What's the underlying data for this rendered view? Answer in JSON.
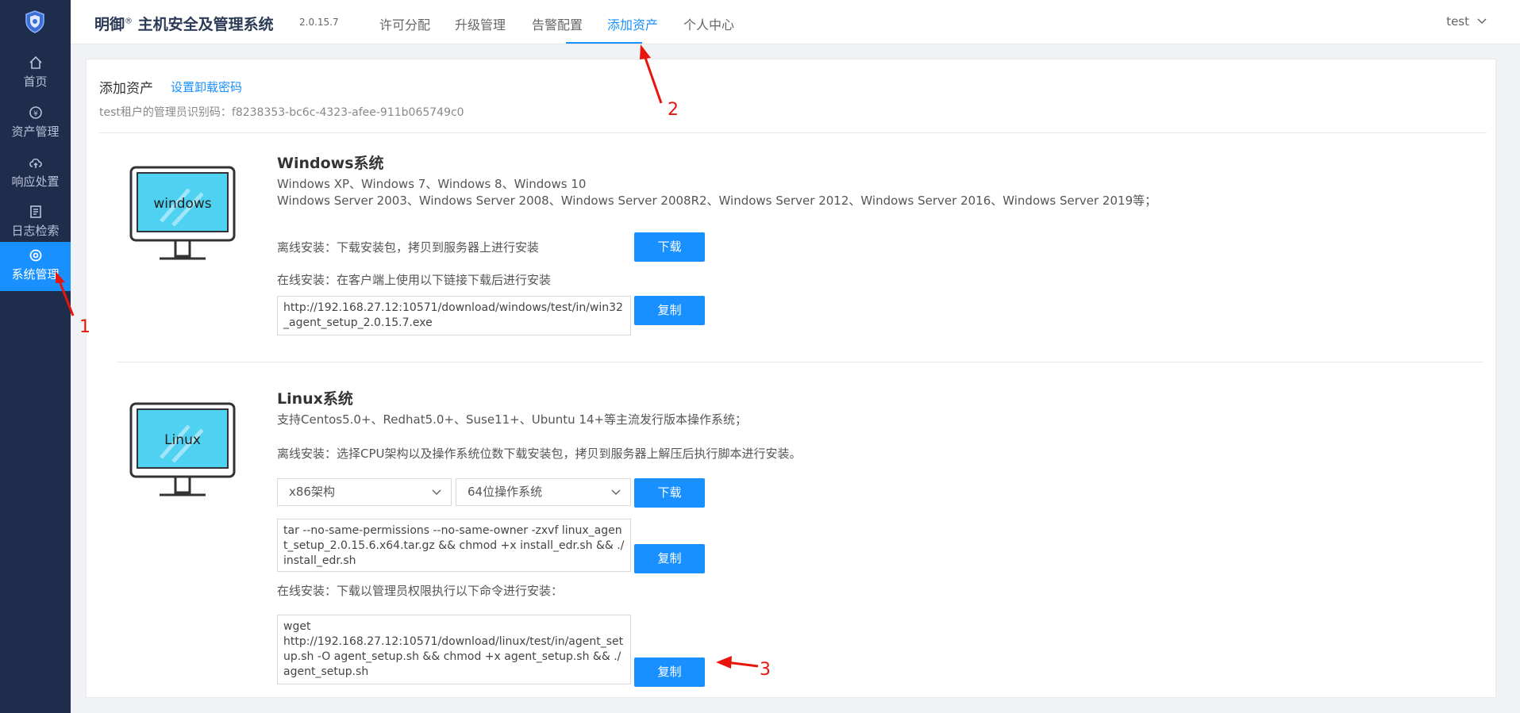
{
  "sidebar": {
    "items": [
      {
        "label": "首页",
        "icon": "home-icon"
      },
      {
        "label": "资产管理",
        "icon": "asset-icon"
      },
      {
        "label": "响应处置",
        "icon": "cloud-upload-icon"
      },
      {
        "label": "日志检索",
        "icon": "log-icon"
      },
      {
        "label": "系统管理",
        "icon": "gear-icon",
        "active": true
      }
    ]
  },
  "header": {
    "brand": "明御",
    "brand_reg": "®",
    "brand_rest": "主机安全及管理系统",
    "version": "2.0.15.7",
    "tabs": [
      "许可分配",
      "升级管理",
      "告警配置",
      "添加资产",
      "个人中心"
    ],
    "active_tab": "添加资产",
    "user": "test"
  },
  "main": {
    "title": "添加资产",
    "set_password_link": "设置卸载密码",
    "tenant_line": "test租户的管理员识别码：f8238353-bc6c-4323-afee-911b065749c0",
    "windows": {
      "monitor_label": "windows",
      "title": "Windows系统",
      "versions_line1": "Windows XP、Windows 7、Windows 8、Windows 10",
      "versions_line2": "Windows Server 2003、Windows Server 2008、Windows Server 2008R2、Windows Server 2012、Windows Server 2016、Windows Server 2019等；",
      "offline_text": "离线安装：下载安装包，拷贝到服务器上进行安装",
      "download_label": "下载",
      "online_text": "在线安装：在客户端上使用以下链接下载后进行安装",
      "online_url": "http://192.168.27.12:10571/download/windows/test/in/win32_agent_setup_2.0.15.7.exe",
      "copy_label": "复制"
    },
    "linux": {
      "monitor_label": "Linux",
      "title": "Linux系统",
      "support_text": "支持Centos5.0+、Redhat5.0+、Suse11+、Ubuntu 14+等主流发行版本操作系统；",
      "offline_text": "离线安装：选择CPU架构以及操作系统位数下载安装包，拷贝到服务器上解压后执行脚本进行安装。",
      "arch_select": "x86架构",
      "bits_select": "64位操作系统",
      "download_label": "下载",
      "offline_cmd": "tar --no-same-permissions --no-same-owner -zxvf linux_agent_setup_2.0.15.6.x64.tar.gz && chmod +x install_edr.sh && ./install_edr.sh",
      "copy_label": "复制",
      "online_text": "在线安装：下载以管理员权限执行以下命令进行安装：",
      "online_cmd": "wget\nhttp://192.168.27.12:10571/download/linux/test/in/agent_setup.sh -O agent_setup.sh && chmod +x agent_setup.sh && ./agent_setup.sh",
      "copy_label2": "复制"
    }
  },
  "annotations": [
    "1",
    "2",
    "3"
  ],
  "colors": {
    "sidebar": "#1f2d4d",
    "accent": "#1890ff",
    "annotation": "#e8150c"
  }
}
